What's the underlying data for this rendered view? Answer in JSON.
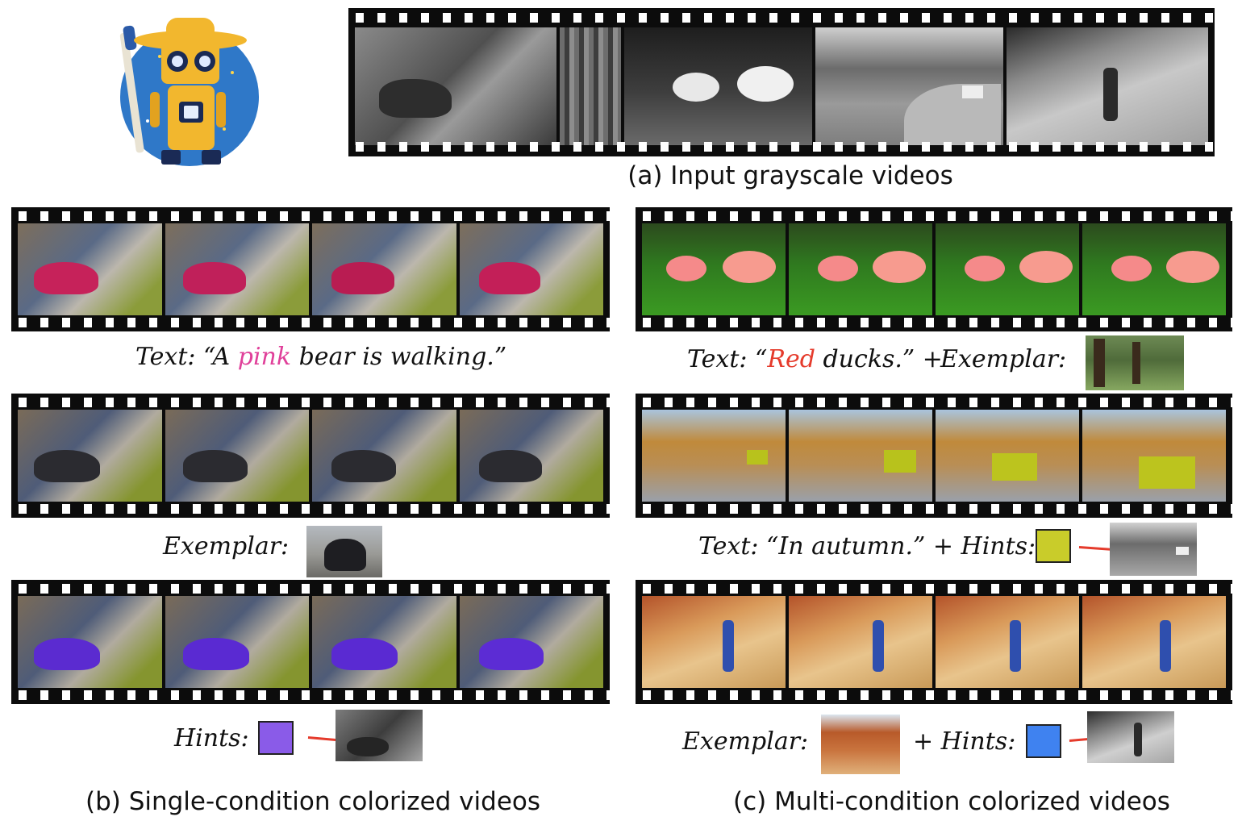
{
  "top": {
    "caption": "(a) Input grayscale videos",
    "robot_logo": "robot-painter-logo"
  },
  "left_panel": {
    "caption": "(b) Single-condition colorized videos",
    "conditions": [
      {
        "prefix": "Text: “A ",
        "highlight": "pink",
        "suffix": " bear is walking.”"
      },
      {
        "label": "Exemplar:"
      },
      {
        "label": "Hints:"
      }
    ]
  },
  "right_panel": {
    "caption": "(c) Multi-condition colorized videos",
    "conditions": [
      {
        "prefix": "Text: “",
        "highlight": "Red",
        "suffix": " ducks.” +",
        "second": "Exemplar:"
      },
      {
        "label": "Text: “In autumn.” + Hints:"
      },
      {
        "label": "Exemplar:",
        "second": "+ Hints:"
      }
    ]
  },
  "colors": {
    "pink_hint": "#e0409a",
    "red_text": "#e53b2c",
    "purple_hint_swatch": "#8a5be8",
    "yellow_hint_swatch": "#c9cc2a",
    "blue_hint_swatch": "#3f82f0",
    "arrow": "#e53b2c"
  }
}
